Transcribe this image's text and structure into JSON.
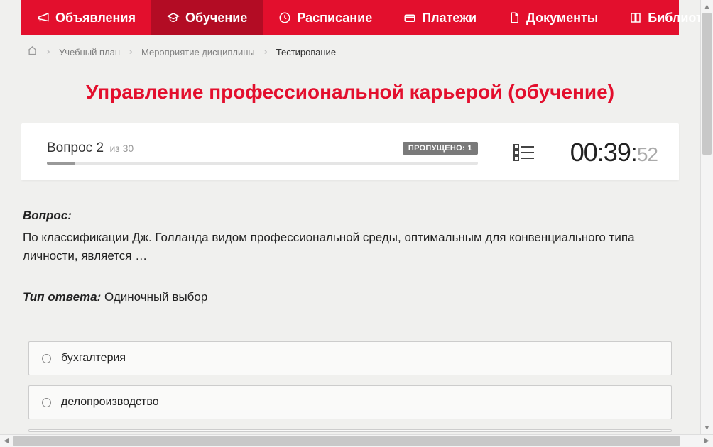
{
  "nav": {
    "items": [
      {
        "label": "Объявления",
        "icon": "megaphone"
      },
      {
        "label": "Обучение",
        "icon": "graduation",
        "active": true
      },
      {
        "label": "Расписание",
        "icon": "clock"
      },
      {
        "label": "Платежи",
        "icon": "payment"
      },
      {
        "label": "Документы",
        "icon": "document"
      },
      {
        "label": "Библиотека",
        "icon": "book",
        "dropdown": true
      }
    ]
  },
  "breadcrumbs": {
    "items": [
      "Учебный план",
      "Мероприятие дисциплины",
      "Тестирование"
    ]
  },
  "page_title": "Управление профессиональной карьерой (обучение)",
  "status": {
    "question_label": "Вопрос 2",
    "total_label": "из 30",
    "skipped_label": "ПРОПУЩЕНО: 1",
    "timer_main": "00:39:",
    "timer_sec": "52"
  },
  "question": {
    "label": "Вопрос:",
    "text": "По классификации Дж. Голланда видом профессиональной среды, оптимальным для конвенциального типа личности, является …",
    "answer_type_label": "Тип ответа:",
    "answer_type_value": " Одиночный выбор"
  },
  "answers": [
    {
      "label": "бухгалтерия"
    },
    {
      "label": "делопроизводство"
    }
  ]
}
